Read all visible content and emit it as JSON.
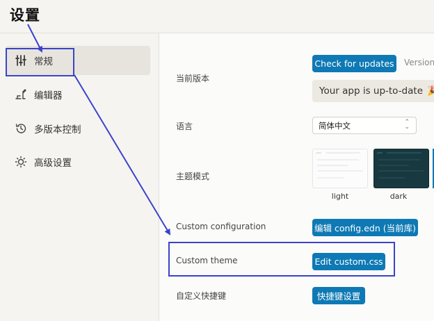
{
  "page": {
    "title": "设置"
  },
  "sidebar": {
    "items": [
      {
        "label": "常规",
        "icon": "sliders-icon",
        "active": true
      },
      {
        "label": "编辑器",
        "icon": "editor-icon",
        "active": false
      },
      {
        "label": "多版本控制",
        "icon": "history-icon",
        "active": false
      },
      {
        "label": "高级设置",
        "icon": "lightbulb-icon",
        "active": false
      }
    ]
  },
  "general": {
    "version": {
      "label": "当前版本",
      "check_button": "Check for updates",
      "version_text": "Version",
      "status": "Your app is up-to-date",
      "status_icon": "🎉"
    },
    "language": {
      "label": "语言",
      "selected": "简体中文",
      "chevron": "⌃⌄"
    },
    "theme": {
      "label": "主题模式",
      "options": [
        {
          "caption": "light"
        },
        {
          "caption": "dark"
        }
      ]
    },
    "custom_config": {
      "label": "Custom configuration",
      "button": "编辑 config.edn (当前库)"
    },
    "custom_theme": {
      "label": "Custom theme",
      "button": "Edit custom.css"
    },
    "shortcuts": {
      "label": "自定义快捷键",
      "button": "快捷键设置"
    }
  },
  "colors": {
    "accent": "#0e79b4",
    "annotation": "#3b43c9",
    "active_bg": "#e7e4de"
  }
}
